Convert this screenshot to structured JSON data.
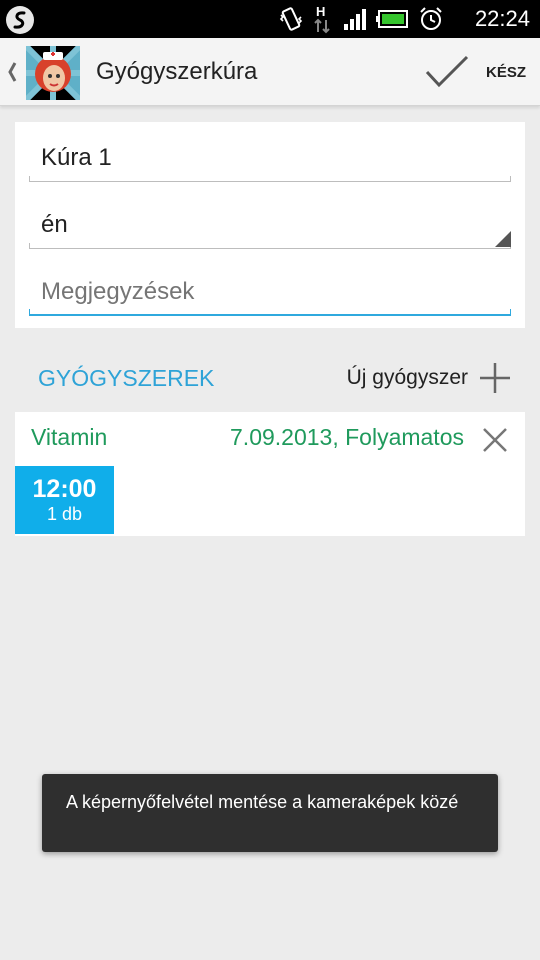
{
  "status_bar": {
    "time": "22:24",
    "network_label": "H",
    "icons": [
      "app-notification-icon",
      "vibrate-icon",
      "network-h-icon",
      "signal-icon",
      "battery-icon",
      "alarm-icon"
    ],
    "colors": {
      "background": "#000000",
      "battery": "#35c42d"
    }
  },
  "action_bar": {
    "title": "Gyógyszerkúra",
    "done_label": "KÉSZ",
    "icons": [
      "back-caret-icon",
      "app-avatar-icon",
      "checkmark-icon"
    ]
  },
  "form": {
    "name_value": "Kúra 1",
    "person_value": "én",
    "notes_placeholder": "Megjegyzések",
    "notes_value": ""
  },
  "medicines_section": {
    "title": "GYÓGYSZEREK",
    "add_label": "Új gyógyszer",
    "add_icon": "plus-icon"
  },
  "medicines": [
    {
      "name": "Vitamin",
      "schedule": "7.09.2013, Folyamatos",
      "remove_icon": "close-icon",
      "doses": [
        {
          "time": "12:00",
          "quantity": "1 db"
        }
      ]
    }
  ],
  "toast": {
    "message": "A képernyőfelvétel mentése a kameraképek közé"
  },
  "colors": {
    "accent_blue": "#2ea3d7",
    "medicine_green": "#1f9a5c",
    "dose_blue": "#10aeea",
    "toast_bg": "#2f2f2f",
    "page_bg": "#ececec"
  }
}
